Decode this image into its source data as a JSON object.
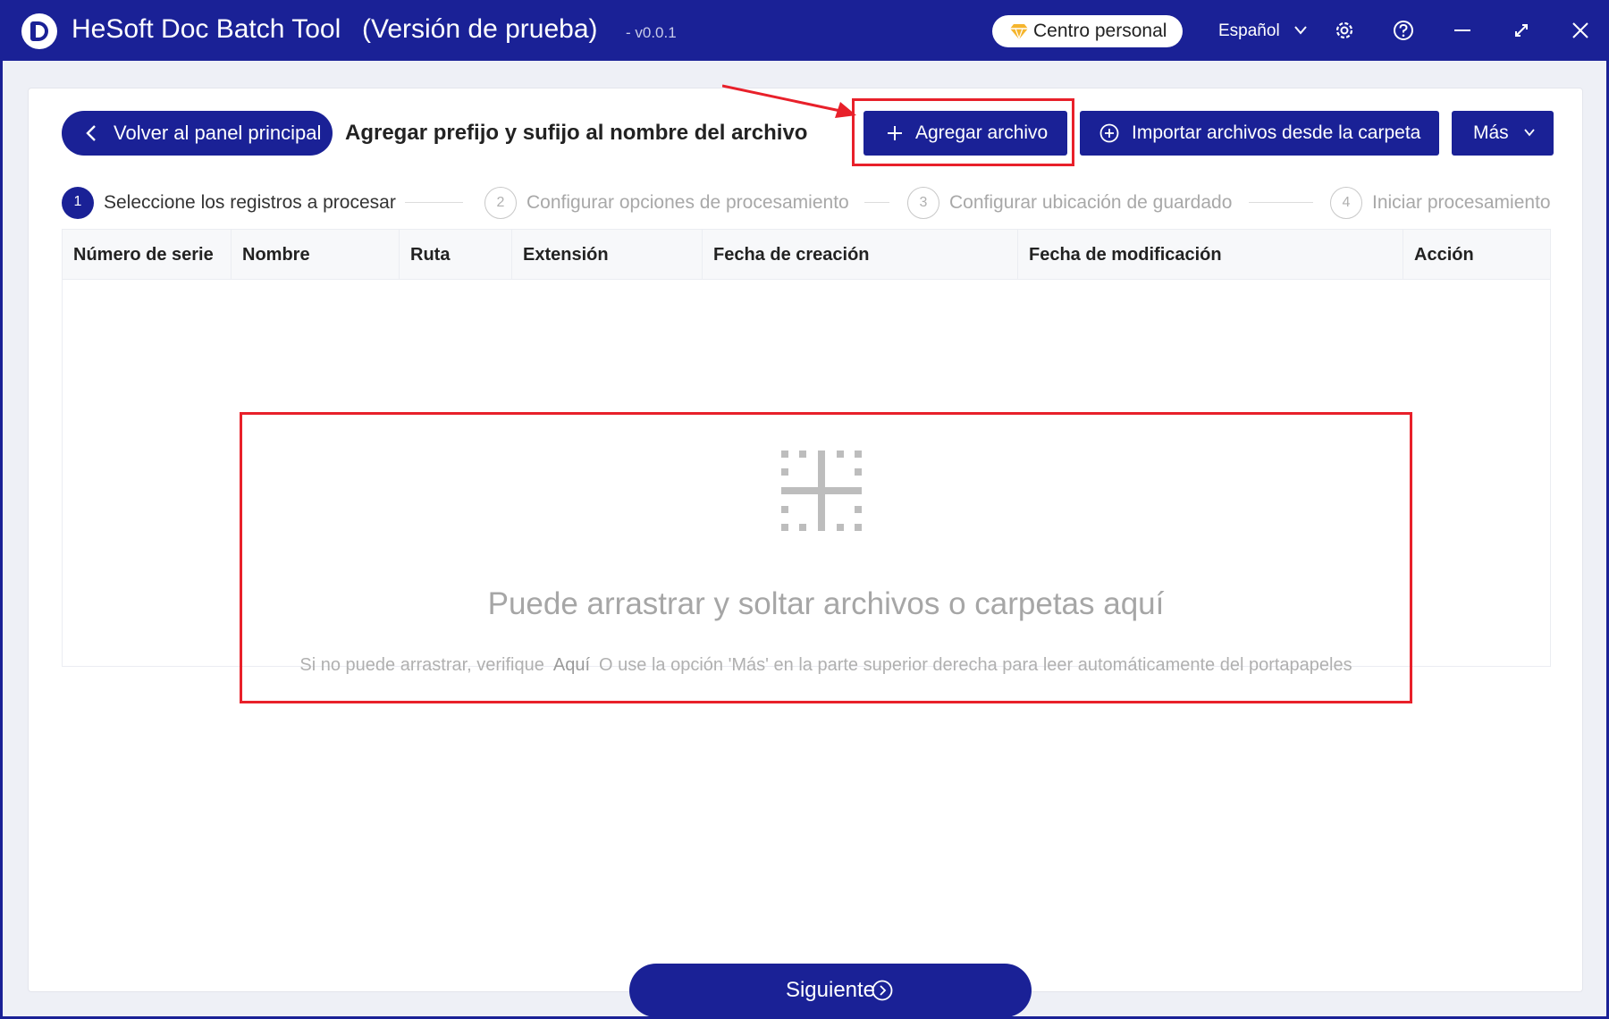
{
  "window": {
    "app_title": "HeSoft Doc Batch Tool",
    "trial_label": "(Versión de prueba)",
    "version": "- v0.0.1",
    "personal_center": "Centro personal",
    "language": "Español"
  },
  "header": {
    "back_label": "Volver al panel principal",
    "page_title": "Agregar prefijo y sufijo al nombre del archivo",
    "add_file_label": "Agregar archivo",
    "import_folder_label": "Importar archivos desde la carpeta",
    "more_label": "Más"
  },
  "steps": [
    {
      "num": "1",
      "label": "Seleccione los registros a procesar",
      "active": true
    },
    {
      "num": "2",
      "label": "Configurar opciones de procesamiento",
      "active": false
    },
    {
      "num": "3",
      "label": "Configurar ubicación de guardado",
      "active": false
    },
    {
      "num": "4",
      "label": "Iniciar procesamiento",
      "active": false
    }
  ],
  "table": {
    "columns": [
      "Número de serie",
      "Nombre",
      "Ruta",
      "Extensión",
      "Fecha de creación",
      "Fecha de modificación",
      "Acción"
    ],
    "rows": []
  },
  "dropzone": {
    "main_text": "Puede arrastrar y soltar archivos o carpetas aquí",
    "sub_text_before": "Si no puede arrastrar, verifique",
    "sub_link": "Aquí",
    "sub_text_after": "O use la opción 'Más' en la parte superior derecha para leer automáticamente del portapapeles"
  },
  "footer": {
    "next_label": "Siguiente"
  },
  "colors": {
    "brand": "#1a2196",
    "highlight": "#e8202a",
    "diamond": "#f5b52e"
  },
  "icons": [
    "logo-icon",
    "diamond-icon",
    "chevron-down-icon",
    "gear-icon",
    "help-icon",
    "minimize-icon",
    "maximize-icon",
    "close-icon",
    "chevron-left-icon",
    "plus-icon",
    "plus-circle-icon",
    "drop-target-icon",
    "arrow-right-circle-icon"
  ]
}
